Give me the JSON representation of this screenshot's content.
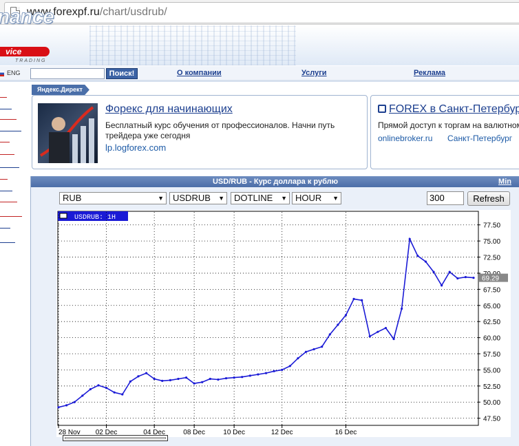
{
  "browser": {
    "url_host": "www.forexpf.ru",
    "url_path": "/chart/usdrub/"
  },
  "header": {
    "logo_line1": "nance",
    "logo_line2": "vice",
    "logo_line3": "TRADING"
  },
  "nav": {
    "lang": "ENG",
    "search_button": "Поиск!",
    "links": [
      "О компании",
      "Услуги",
      "Реклама"
    ]
  },
  "sidebar": {
    "items": [
      {
        "label": "",
        "color": "#c22222"
      },
      {
        "label": "",
        "color": "#1c3f8f"
      },
      {
        "label": "",
        "color": "#c22222"
      },
      {
        "label": "",
        "color": "#1c3f8f"
      },
      {
        "label": "",
        "color": "#c22222"
      },
      {
        "label": "",
        "color": "#c22222"
      },
      {
        "label": "",
        "color": "#1c3f8f"
      },
      {
        "label": "",
        "color": "#c22222"
      },
      {
        "label": "",
        "color": "#1c3f8f"
      },
      {
        "label": "",
        "color": "#c22222"
      },
      {
        "label": "",
        "color": "#c22222"
      },
      {
        "label": "",
        "color": "#1c3f8f"
      },
      {
        "label": "",
        "color": "#1c3f8f"
      }
    ]
  },
  "ads": {
    "tag": "Яндекс.Директ",
    "ad1": {
      "title": "Форекс для начинающих",
      "text": "Бесплатный курс обучения от профессионалов. Начни путь трейдера уже сегодня",
      "link": "lp.logforex.com"
    },
    "ad2": {
      "title": "FOREX в Санкт-Петербург",
      "text": "Прямой доступ к торгам на валютном",
      "link1": "onlinebroker.ru",
      "link2": "Санкт-Петербург"
    }
  },
  "panel": {
    "title": "USD/RUB - Курс доллара к рублю",
    "min_link": "Min"
  },
  "controls": {
    "currency": "RUB",
    "pair": "USDRUB",
    "style": "DOTLINE",
    "period": "HOUR",
    "count": "300",
    "refresh": "Refresh"
  },
  "chart_data": {
    "type": "line",
    "title": "USDRUB: 1H",
    "series": [
      {
        "name": "USDRUB",
        "color": "#1a1ad6"
      }
    ],
    "x_ticks": [
      "28 Nov",
      "02 Dec",
      "04 Dec",
      "08 Dec",
      "10 Dec",
      "12 Dec",
      "16 Dec"
    ],
    "x": [
      "28 Nov",
      "29 Nov",
      "29 Nov",
      "01 Dec",
      "01 Dec",
      "01 Dec",
      "02 Dec",
      "02 Dec",
      "02 Dec",
      "03 Dec",
      "03 Dec",
      "03 Dec",
      "04 Dec",
      "04 Dec",
      "05 Dec",
      "05 Dec",
      "05 Dec",
      "08 Dec",
      "08 Dec",
      "08 Dec",
      "09 Dec",
      "09 Dec",
      "10 Dec",
      "10 Dec",
      "10 Dec",
      "11 Dec",
      "11 Dec",
      "11 Dec",
      "12 Dec",
      "12 Dec",
      "12 Dec",
      "15 Dec",
      "15 Dec",
      "15 Dec",
      "15 Dec",
      "15 Dec",
      "16 Dec",
      "16 Dec",
      "16 Dec",
      "16 Dec",
      "16 Dec",
      "16 Dec",
      "16 Dec",
      "16 Dec",
      "16 Dec",
      "17 Dec",
      "17 Dec",
      "17 Dec",
      "17 Dec",
      "17 Dec",
      "17 Dec",
      "17 Dec",
      "17 Dec"
    ],
    "values": [
      49.2,
      49.5,
      50.0,
      51.0,
      52.0,
      52.6,
      52.2,
      51.5,
      51.2,
      53.2,
      54.0,
      54.5,
      53.6,
      53.3,
      53.4,
      53.6,
      53.8,
      52.9,
      53.1,
      53.6,
      53.5,
      53.7,
      53.8,
      53.9,
      54.1,
      54.3,
      54.5,
      54.8,
      55.0,
      55.6,
      56.8,
      57.8,
      58.2,
      58.6,
      60.5,
      62.0,
      63.5,
      66.0,
      65.8,
      60.2,
      60.9,
      61.5,
      59.8,
      64.5,
      75.3,
      72.7,
      71.8,
      70.2,
      68.1,
      70.2,
      69.2,
      69.4,
      69.29
    ],
    "ylim": [
      46.5,
      79.5
    ],
    "y_ticks": [
      47.5,
      50.0,
      52.5,
      55.0,
      57.5,
      60.0,
      62.5,
      65.0,
      67.5,
      70.0,
      72.5,
      75.0,
      77.5
    ],
    "y_tick_labels": [
      "47.50",
      "50.00",
      "52.50",
      "55.00",
      "57.50",
      "60.00",
      "62.50",
      "65.00",
      "67.50",
      "70.00",
      "72.50",
      "75.00",
      "77.50"
    ],
    "last_value": 69.29,
    "last_label": "69.29",
    "grid": true
  }
}
